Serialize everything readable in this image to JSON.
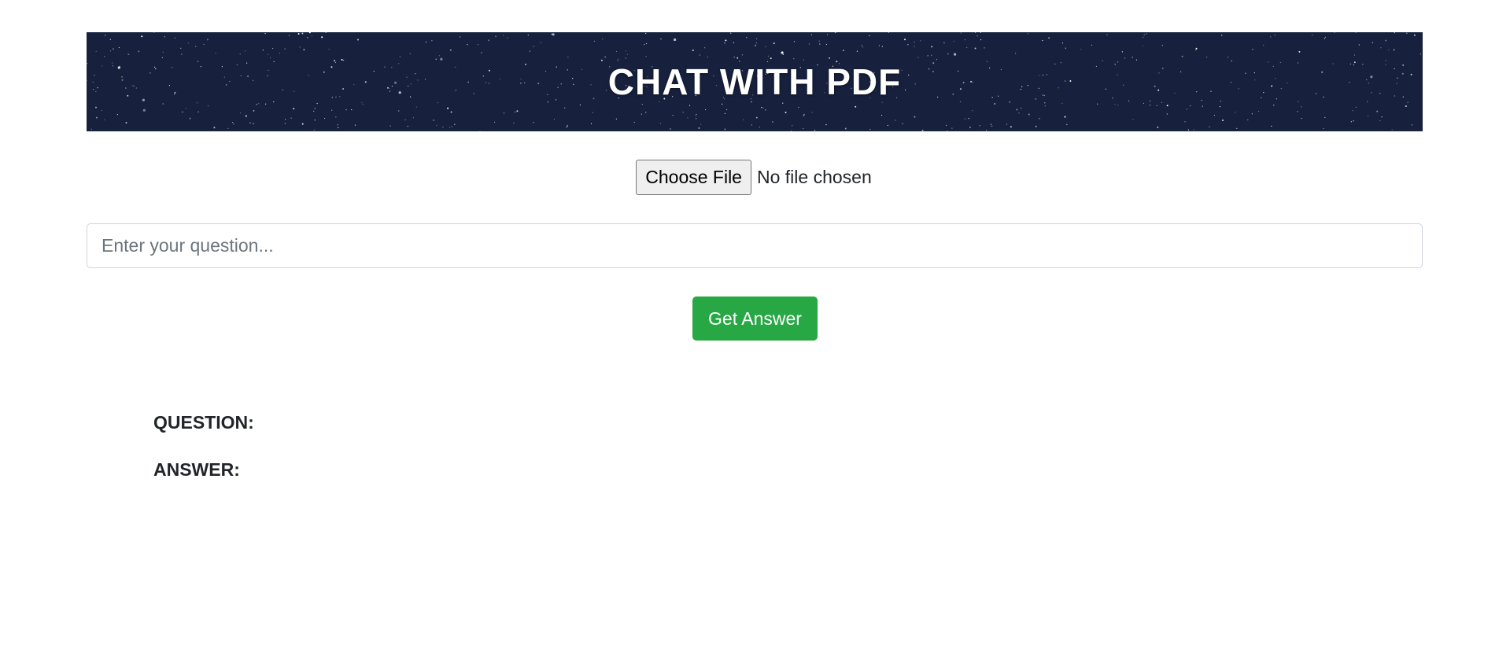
{
  "header": {
    "title": "CHAT WITH PDF"
  },
  "file_upload": {
    "button_label": "Choose File",
    "status": "No file chosen"
  },
  "question_input": {
    "placeholder": "Enter your question...",
    "value": ""
  },
  "actions": {
    "submit_label": "Get Answer"
  },
  "result": {
    "question_label": "QUESTION:",
    "answer_label": "ANSWER:"
  },
  "colors": {
    "banner_bg": "#141c33",
    "button_green": "#28a745"
  }
}
